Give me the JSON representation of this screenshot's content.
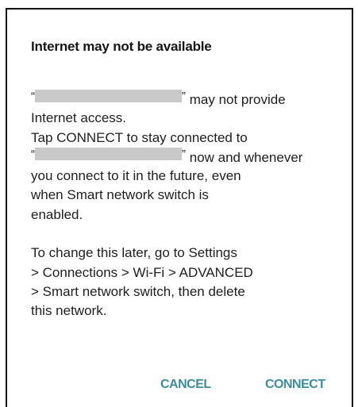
{
  "dialog": {
    "title": "Internet may not be available",
    "open_quote": "“",
    "close_quote": "”",
    "line1_tail": "may not provide",
    "line2": "Internet access.",
    "line3": "Tap CONNECT to stay connected to",
    "line4_tail": "now and whenever",
    "line5": "you connect to it in the future, even",
    "line6": "when Smart network switch is",
    "line7": "enabled.",
    "line8": "To change this later, go to Settings",
    "line9": "> Connections > Wi-Fi > ADVANCED",
    "line10": "> Smart network switch, then delete",
    "line11": "this network.",
    "cancel_label": "CANCEL",
    "connect_label": "CONNECT"
  },
  "colors": {
    "accent": "#3e8d9a",
    "redaction": "#c9c9c9",
    "text": "#1e1e1e"
  }
}
